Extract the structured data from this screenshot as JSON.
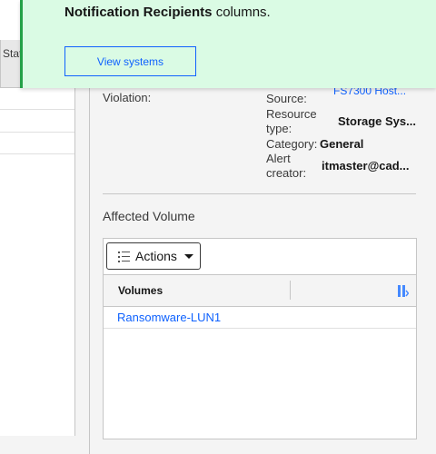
{
  "background_table": {
    "column_header": "Stat"
  },
  "details": {
    "violation_label": "Violation:",
    "source_label": "Source:",
    "source_value": "FS7300 Host...",
    "resource_type_label_1": "Resource",
    "resource_type_label_2": "type:",
    "resource_type_value": "Storage Sys...",
    "category_label": "Category:",
    "category_value": "General",
    "alert_creator_label_1": "Alert",
    "alert_creator_label_2": "creator:",
    "alert_creator_value": "itmaster@cad..."
  },
  "affected_volume": {
    "title": "Affected Volume",
    "actions_label": "Actions",
    "column_header": "Volumes",
    "rows": [
      "Ransomware-LUN1"
    ]
  },
  "toast": {
    "text_bold": "Notification Recipients",
    "text_rest": " columns.",
    "button_label": "View systems",
    "accent_color": "#24a148",
    "background_color": "#dafbe4"
  },
  "colors": {
    "link": "#0f62fe"
  }
}
